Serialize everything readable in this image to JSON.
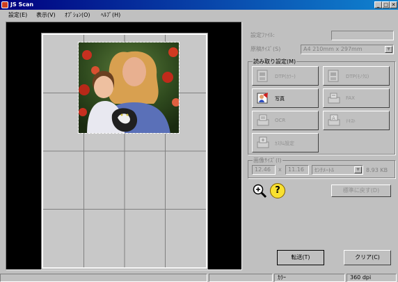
{
  "window": {
    "title": "JS Scan",
    "min": "_",
    "max": "□",
    "close": "✕"
  },
  "menu": [
    "設定(E)",
    "表示(V)",
    "ｵﾌﾟｼｮﾝ(O)",
    "ﾍﾙﾌﾟ(H)"
  ],
  "settings": {
    "settings_file_label": "設定ﾌｧｲﾙ:",
    "settings_file_value": "",
    "original_size_label": "原稿ｻｲｽﾞ(S)",
    "original_size_value": "A4 210mm x 297mm"
  },
  "read_settings": {
    "title": "読み取り設定(M)",
    "modes": [
      {
        "label": "DTP(ｶﾗｰ)",
        "icon": "dtp-color-icon",
        "enabled": false
      },
      {
        "label": "DTP(ﾓﾉｸﾛ)",
        "icon": "dtp-mono-icon",
        "enabled": false
      },
      {
        "label": "写真",
        "icon": "photo-icon",
        "enabled": true
      },
      {
        "label": "FAX",
        "icon": "fax-icon",
        "enabled": false
      },
      {
        "label": "OCR",
        "icon": "ocr-icon",
        "enabled": false
      },
      {
        "label": "ﾃｷｽﾄ",
        "icon": "text-icon",
        "enabled": false
      },
      {
        "label": "ｶｽﾀﾑ設定",
        "icon": "custom-icon",
        "enabled": false
      }
    ]
  },
  "image_size": {
    "title": "画像ｻｲｽﾞ(I)",
    "width": "12.46",
    "times": "x",
    "height": "11.16",
    "unit": "ｾﾝﾁﾒｰﾄﾙ",
    "filesize": "8.93 KB"
  },
  "tools": {
    "zoom_icon": "zoom-in-icon",
    "help_icon": "help-icon",
    "help_glyph": "?"
  },
  "buttons": {
    "reset": "標準に戻す(D)",
    "transfer": "転送(T)",
    "clear": "クリア(C)"
  },
  "status": {
    "mode": "ｶﾗｰ",
    "dpi": "360 dpi"
  },
  "colors": {
    "title_bar": "#000080",
    "face": "#c0c0c0",
    "preview_bg": "#000000"
  }
}
